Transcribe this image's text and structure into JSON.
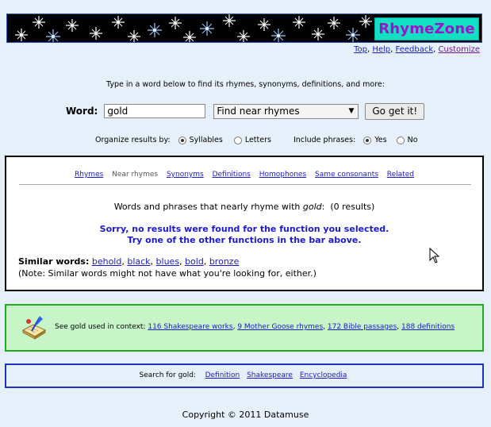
{
  "banner": {
    "logo_text": "RhymeZone"
  },
  "top_links": [
    {
      "label": "Top",
      "color": "#1a1acc"
    },
    {
      "label": "Help",
      "color": "#1a1acc"
    },
    {
      "label": "Feedback",
      "color": "#1a1acc"
    },
    {
      "label": "Customize",
      "color": "#6a1a8a"
    }
  ],
  "intro_text": "Type in a word below to find its rhymes, synonyms, definitions, and more:",
  "search": {
    "word_label": "Word:",
    "word_value": "gold",
    "function_selected": "Find near rhymes",
    "go_label": "Go get it!"
  },
  "options": {
    "organize_label": "Organize results by:",
    "syllables_label": "Syllables",
    "letters_label": "Letters",
    "include_label": "Include phrases:",
    "yes_label": "Yes",
    "no_label": "No"
  },
  "results": {
    "tabs": [
      "Rhymes",
      "Near rhymes",
      "Synonyms",
      "Definitions",
      "Homophones",
      "Same consonants",
      "Related"
    ],
    "current_tab": "Near rhymes",
    "heading_prefix": "Words and phrases that nearly rhyme with",
    "heading_word": "gold",
    "heading_suffix": ":",
    "result_count": "(0 results)",
    "sorry_line1": "Sorry, no results were found for the function you selected.",
    "sorry_line2": "Try one of the other functions in the bar above.",
    "similar_label": "Similar words:",
    "similar_words": [
      "behold",
      "black",
      "blues",
      "bold",
      "bronze"
    ],
    "similar_note": "(Note: Similar words might not have what you're looking for, either.)"
  },
  "context": {
    "prefix": "See gold used in context:",
    "links": [
      "116 Shakespeare works",
      "9 Mother Goose rhymes",
      "172 Bible passages",
      "188 definitions"
    ]
  },
  "search_for": {
    "label": "Search for gold:",
    "links": [
      "Definition",
      "Shakespeare",
      "Encyclopedia"
    ]
  },
  "copyright": "Copyright © 2011 Datamuse",
  "colors": {
    "page_bg": "#e6f0fb",
    "link": "#1a1acc",
    "logo_bg": "#11e0c2",
    "logo_text": "#9a14c8",
    "context_bg": "#c8f5c8",
    "context_border": "#22aa22",
    "searchfor_border": "#2233bb"
  }
}
